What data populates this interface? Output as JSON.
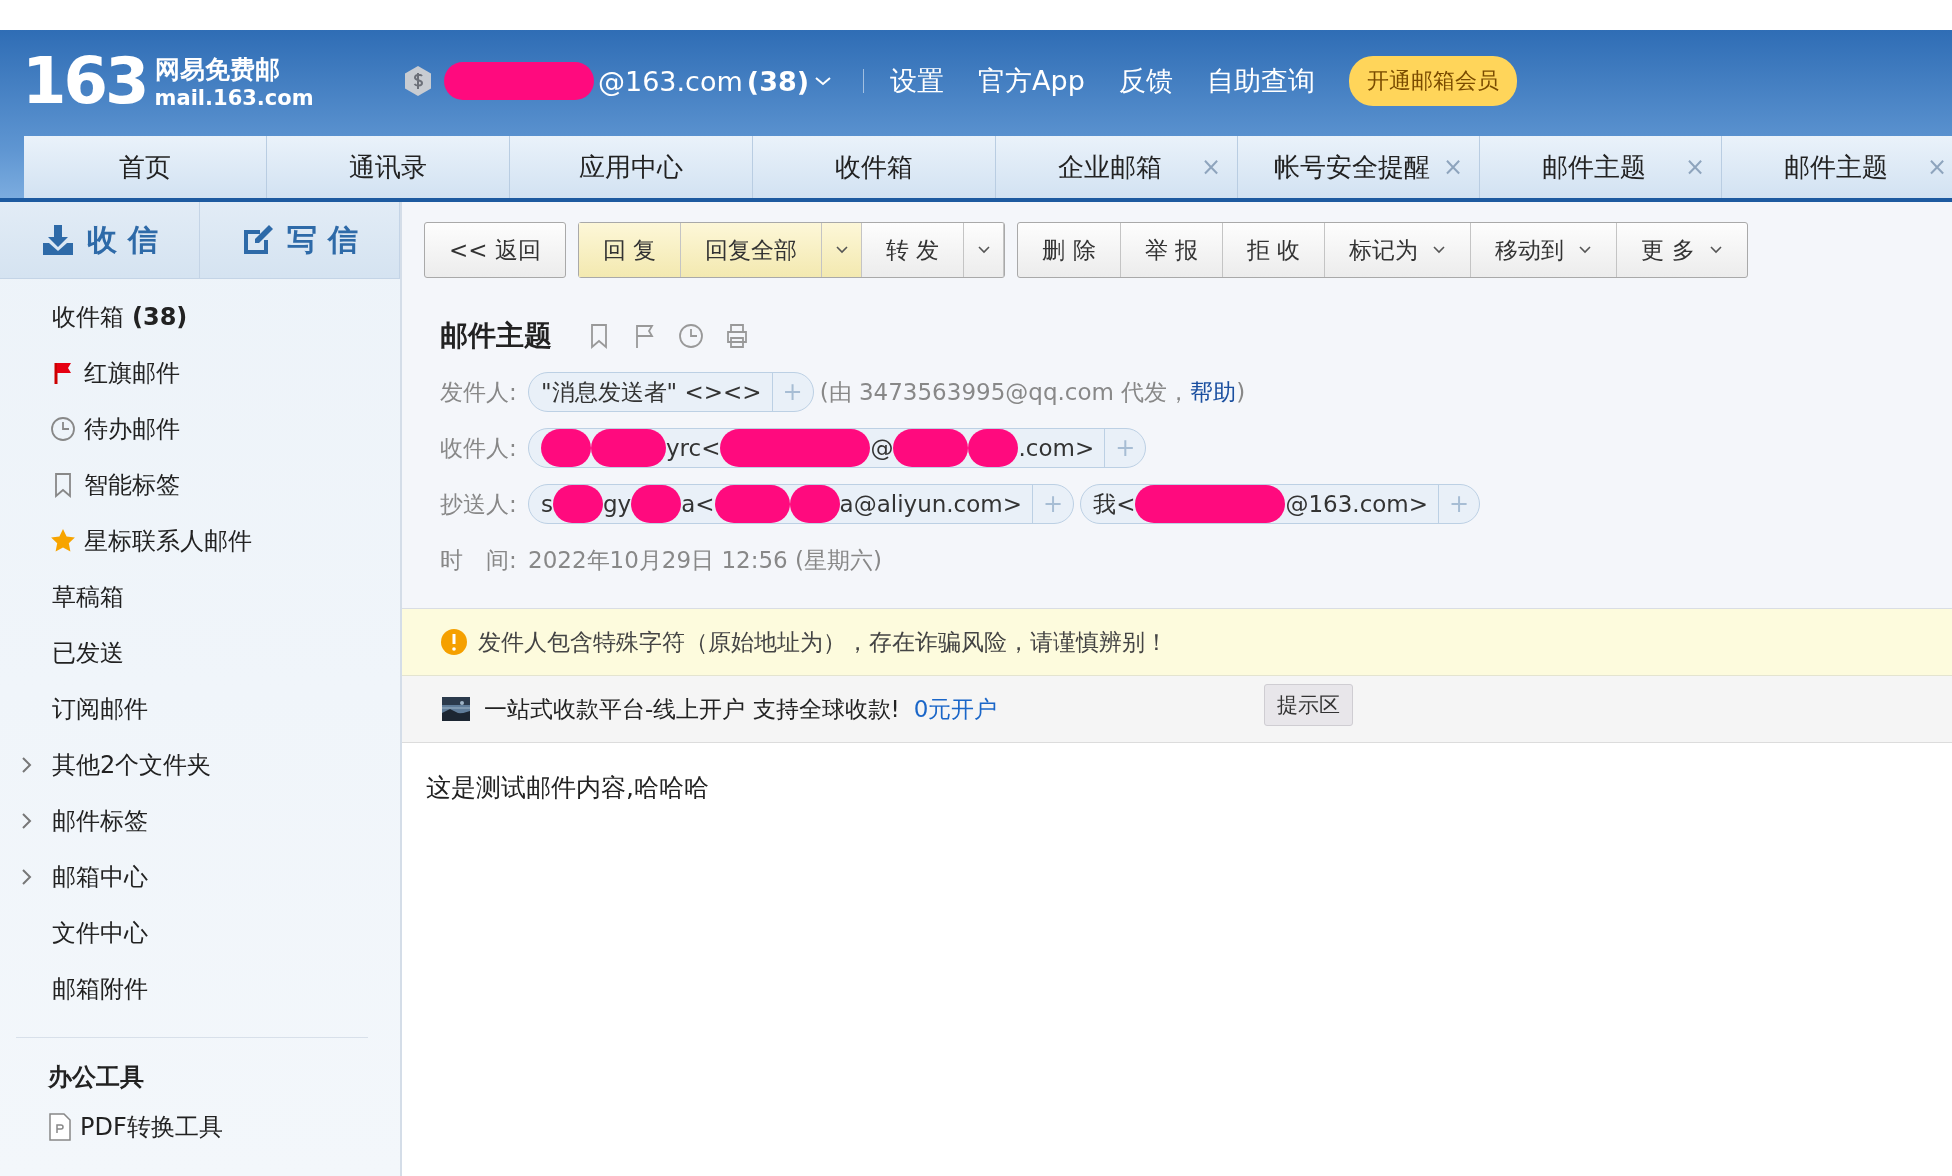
{
  "header": {
    "logo_number": "163",
    "logo_name": "网易免费邮",
    "logo_domain": "mail.163.com",
    "account": {
      "parts": [
        {
          "kind": "streak"
        },
        {
          "kind": "text",
          "text": "@163.com"
        }
      ],
      "count": "(38)"
    },
    "links": [
      "设置",
      "官方App",
      "反馈",
      "自助查询"
    ],
    "vip_button": "开通邮箱会员"
  },
  "tabs": [
    {
      "label": "首页"
    },
    {
      "label": "通讯录"
    },
    {
      "label": "应用中心"
    },
    {
      "label": "收件箱"
    },
    {
      "label": "企业邮箱",
      "close": "×"
    },
    {
      "label": "帐号安全提醒",
      "close": "×"
    },
    {
      "label": "邮件主题",
      "close": "×"
    },
    {
      "label": "邮件主题",
      "close": "×"
    }
  ],
  "sidebar": {
    "actions": [
      {
        "label": "收 信",
        "kind": "receive"
      },
      {
        "label": "写 信",
        "kind": "compose"
      }
    ],
    "folders": [
      {
        "label": "收件箱",
        "count": "(38)",
        "kind": "plain"
      },
      {
        "label": "红旗邮件",
        "kind": "flag"
      },
      {
        "label": "待办邮件",
        "kind": "clock"
      },
      {
        "label": "智能标签",
        "kind": "tag"
      },
      {
        "label": "星标联系人邮件",
        "kind": "star"
      },
      {
        "label": "草稿箱",
        "kind": "plain"
      },
      {
        "label": "已发送",
        "kind": "plain"
      },
      {
        "label": "订阅邮件",
        "kind": "plain"
      },
      {
        "label": "其他2个文件夹",
        "kind": "group"
      },
      {
        "label": "邮件标签",
        "kind": "group"
      },
      {
        "label": "邮箱中心",
        "kind": "group"
      },
      {
        "label": "文件中心",
        "kind": "plain"
      },
      {
        "label": "邮箱附件",
        "kind": "plain"
      }
    ],
    "tools": {
      "title": "办公工具",
      "items": [
        {
          "label": "PDF转换工具"
        }
      ]
    }
  },
  "toolbar": [
    [
      {
        "label": "<< 返回",
        "kind": "plain",
        "highlight": false
      }
    ],
    [
      {
        "label": "回 复",
        "kind": "plain",
        "highlight": true
      },
      {
        "label": "回复全部",
        "kind": "split",
        "highlight": true
      },
      {
        "label": "转 发",
        "kind": "split",
        "highlight": false
      }
    ],
    [
      {
        "label": "删 除",
        "kind": "plain",
        "highlight": false
      },
      {
        "label": "举 报",
        "kind": "plain",
        "highlight": false
      },
      {
        "label": "拒 收",
        "kind": "plain",
        "highlight": false
      },
      {
        "label": "标记为",
        "kind": "menu",
        "highlight": false
      },
      {
        "label": "移动到",
        "kind": "menu",
        "highlight": false
      },
      {
        "label": "更 多",
        "kind": "menu",
        "highlight": false
      }
    ]
  ],
  "message": {
    "subject": "邮件主题",
    "from": {
      "label": "发件人:",
      "chips": [
        {
          "parts": [
            {
              "kind": "text",
              "text": "\"消息发送者\" <><>"
            }
          ],
          "add": "+"
        }
      ],
      "note_before": "(由 3473563995@qq.com 代发，",
      "note_link": "帮助",
      "note_after": ")"
    },
    "to": {
      "label": "收件人:",
      "chips": [
        {
          "parts": [
            {
              "kind": "dot"
            },
            {
              "kind": "blob"
            },
            {
              "kind": "text",
              "text": "yrc<"
            },
            {
              "kind": "streak"
            },
            {
              "kind": "text",
              "text": "@"
            },
            {
              "kind": "blob"
            },
            {
              "kind": "dot"
            },
            {
              "kind": "text",
              "text": ".com>"
            }
          ],
          "add": "+"
        }
      ]
    },
    "cc": {
      "label": "抄送人:",
      "chips": [
        {
          "parts": [
            {
              "kind": "text",
              "text": "s"
            },
            {
              "kind": "dot"
            },
            {
              "kind": "text",
              "text": "gy"
            },
            {
              "kind": "dot"
            },
            {
              "kind": "text",
              "text": "a<"
            },
            {
              "kind": "blob"
            },
            {
              "kind": "dot"
            },
            {
              "kind": "text",
              "text": "a@aliyun.com>"
            }
          ],
          "add": "+"
        },
        {
          "parts": [
            {
              "kind": "text",
              "text": "我<"
            },
            {
              "kind": "streak"
            },
            {
              "kind": "text",
              "text": "@163.com>"
            }
          ],
          "add": "+"
        }
      ]
    },
    "time": {
      "label": "时　间:",
      "value": "2022年10月29日 12:56 (星期六)"
    },
    "warning": "发件人包含特殊字符（原始地址为），存在诈骗风险，请谨慎辨别！",
    "ad": {
      "text": "一站式收款平台-线上开户 支持全球收款!",
      "link": "0元开户",
      "tooltip": "提示区"
    },
    "body": "这是测试邮件内容,哈哈哈"
  }
}
